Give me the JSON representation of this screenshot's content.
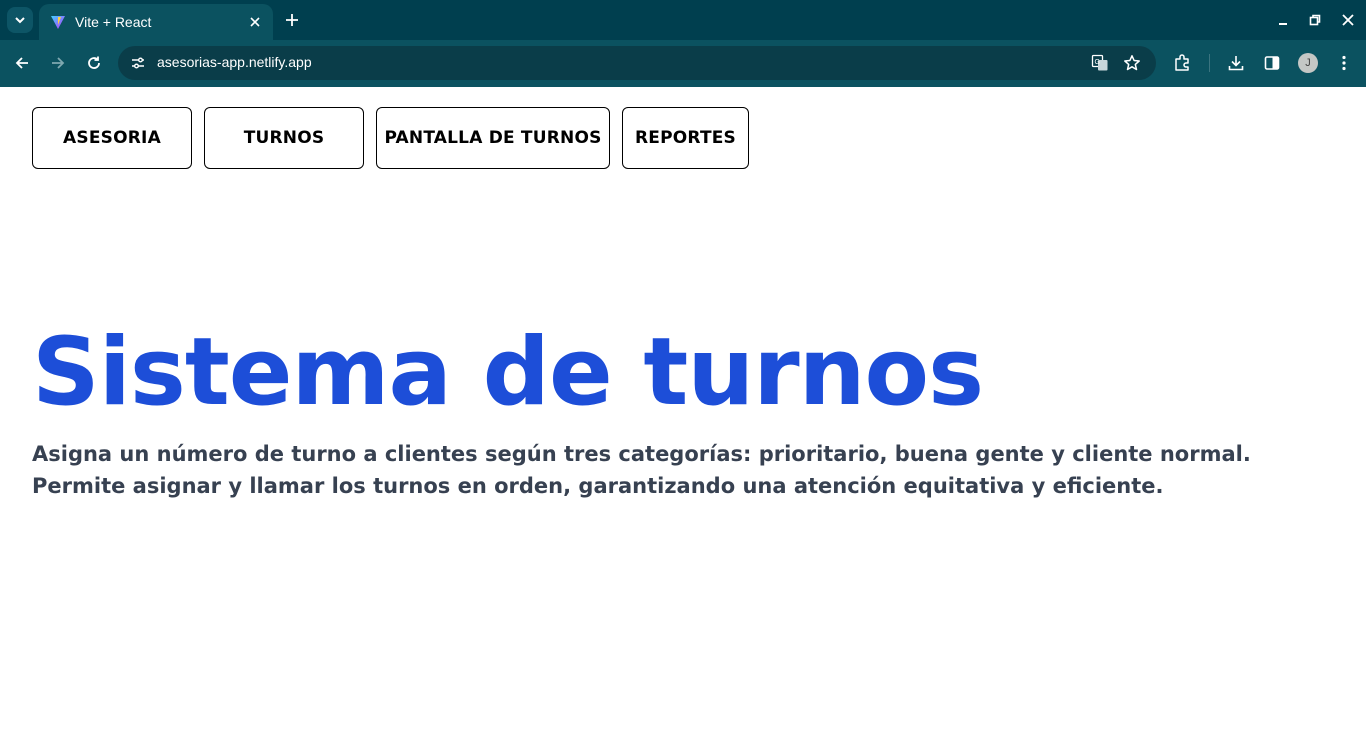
{
  "browser": {
    "tab_title": "Vite + React",
    "url": "asesorias-app.netlify.app",
    "avatar_letter": "J",
    "colors": {
      "tabbar": "#003f4f",
      "toolbar": "#0b5260",
      "omnibox": "#0a3d49"
    }
  },
  "nav": {
    "buttons": [
      "ASESORIA",
      "TURNOS",
      "PANTALLA DE TURNOS",
      "REPORTES"
    ]
  },
  "hero": {
    "title": "Sistema de turnos",
    "description_line1": "Asigna un número de turno a clientes según tres categorías: prioritario, buena gente y cliente normal.",
    "description_line2": "Permite asignar y llamar los turnos en orden, garantizando una atención equitativa y eficiente.",
    "colors": {
      "title": "#1d4ed8",
      "text": "#374151"
    }
  }
}
